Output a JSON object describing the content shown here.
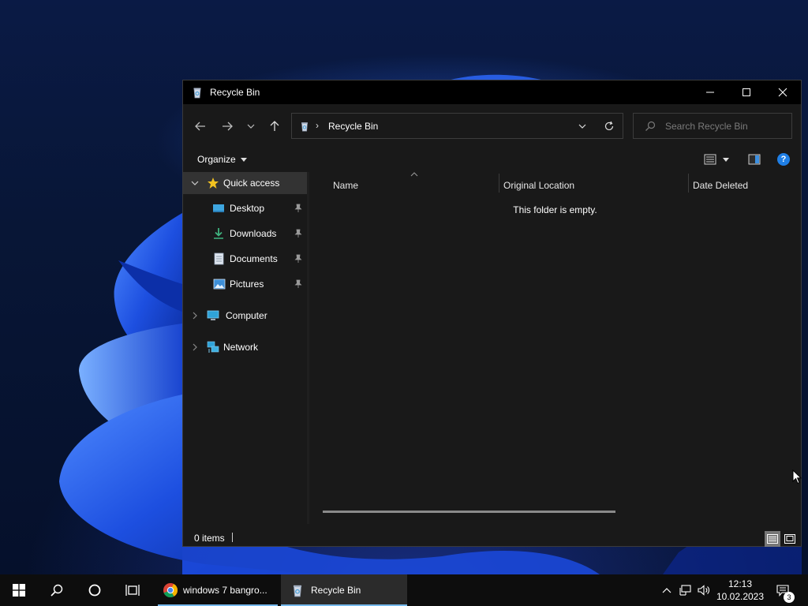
{
  "window": {
    "title": "Recycle Bin",
    "controls": [
      "minimize",
      "maximize",
      "close"
    ]
  },
  "address_bar": {
    "path": "Recycle Bin",
    "search_placeholder": "Search Recycle Bin"
  },
  "command_bar": {
    "organize_label": "Organize"
  },
  "nav_pane": {
    "quick_access": "Quick access",
    "pinned": [
      {
        "label": "Desktop",
        "icon": "desktop-icon"
      },
      {
        "label": "Downloads",
        "icon": "download-icon"
      },
      {
        "label": "Documents",
        "icon": "document-icon"
      },
      {
        "label": "Pictures",
        "icon": "picture-icon"
      }
    ],
    "computer": "Computer",
    "network": "Network"
  },
  "content": {
    "columns": [
      "Name",
      "Original Location",
      "Date Deleted"
    ],
    "empty_message": "This folder is empty."
  },
  "status_bar": {
    "item_count": "0 items"
  },
  "taskbar": {
    "apps": [
      {
        "label": "windows 7 bangro...",
        "icon": "chrome-icon",
        "active": false
      },
      {
        "label": "Recycle Bin",
        "icon": "recycle-bin-icon",
        "active": true
      }
    ],
    "clock_time": "12:13",
    "clock_date": "10.02.2023",
    "notification_count": "3"
  },
  "colors": {
    "accent": "#76b9ed",
    "window_bg": "#191919",
    "titlebar_bg": "#000000",
    "help_blue": "#1f7fe6"
  }
}
